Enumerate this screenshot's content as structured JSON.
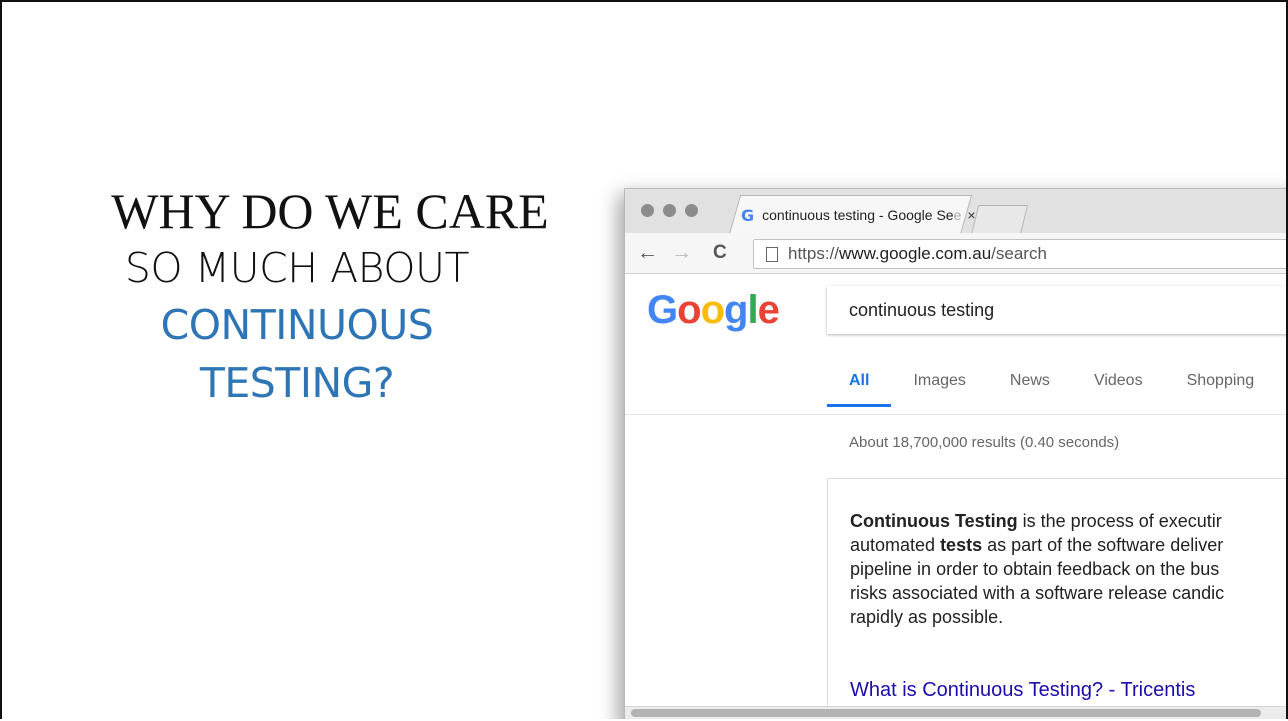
{
  "slide": {
    "title_line1": "WHY DO WE CARE",
    "title_line2": "SO MUCH ABOUT",
    "title_line3": "CONTINUOUS",
    "title_line4": "TESTING?",
    "accent_color": "#2e75b6"
  },
  "browser": {
    "tab": {
      "favicon": "G",
      "title": "continuous testing - Google Se",
      "title_fade": "e",
      "close": "×"
    },
    "nav": {
      "back": "←",
      "forward": "→",
      "reload": "C"
    },
    "address": {
      "scheme": "https://",
      "host": "www.google.com.au",
      "path": "/search"
    },
    "google": {
      "logo_letters": [
        "G",
        "o",
        "o",
        "g",
        "l",
        "e"
      ],
      "logo_colors": [
        "#4285f4",
        "#ea4335",
        "#fbbc05",
        "#4285f4",
        "#34a853",
        "#ea4335"
      ],
      "query": "continuous testing",
      "tabs": [
        "All",
        "Images",
        "News",
        "Videos",
        "Shopping"
      ],
      "active_tab": "All",
      "stats": "About 18,700,000 results (0.40 seconds)",
      "snippet": {
        "line1_bold": "Continuous Testing",
        "line1_rest": " is the process of executir",
        "line2_pre": "automated ",
        "line2_bold": "tests",
        "line2_rest": " as part of the software deliver",
        "line3": "pipeline in order to obtain feedback on the bus",
        "line4": "risks associated with a software release candic",
        "line5": "rapidly as possible.",
        "link": "What is Continuous Testing? - Tricentis"
      }
    }
  }
}
